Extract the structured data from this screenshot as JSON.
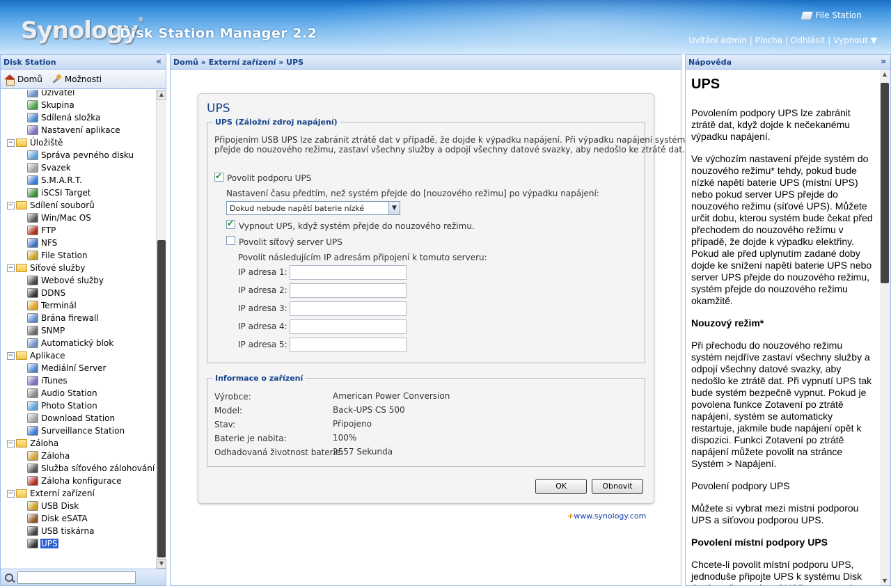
{
  "header": {
    "logo": "Synology",
    "logo_mark": "®",
    "product": "Disk Station Manager 2.2",
    "file_station_link": "File Station",
    "links": [
      "Uvítání admin",
      "Plocha",
      "Odhlásit",
      "Vypnout ▼"
    ]
  },
  "left_panel": {
    "title": "Disk Station",
    "toolbar": {
      "home": "Domů",
      "options": "Možnosti"
    },
    "tree": [
      {
        "label": "Uživatel",
        "indent": 2,
        "icon": "user-icon"
      },
      {
        "label": "Skupina",
        "indent": 2,
        "icon": "group-icon"
      },
      {
        "label": "Sdílená složka",
        "indent": 2,
        "icon": "shared-folder-icon"
      },
      {
        "label": "Nastavení aplikace",
        "indent": 2,
        "icon": "app-settings-icon"
      },
      {
        "label": "Úložiště",
        "indent": 1,
        "folder": true
      },
      {
        "label": "Správa pevného disku",
        "indent": 2,
        "icon": "hdd-icon"
      },
      {
        "label": "Svazek",
        "indent": 2,
        "icon": "volume-icon"
      },
      {
        "label": "S.M.A.R.T.",
        "indent": 2,
        "icon": "smart-icon"
      },
      {
        "label": "iSCSI Target",
        "indent": 2,
        "icon": "iscsi-icon"
      },
      {
        "label": "Sdílení souborů",
        "indent": 1,
        "folder": true
      },
      {
        "label": "Win/Mac OS",
        "indent": 2,
        "icon": "winmac-icon"
      },
      {
        "label": "FTP",
        "indent": 2,
        "icon": "ftp-icon"
      },
      {
        "label": "NFS",
        "indent": 2,
        "icon": "nfs-icon"
      },
      {
        "label": "File Station",
        "indent": 2,
        "icon": "file-station-icon"
      },
      {
        "label": "Síťové služby",
        "indent": 1,
        "folder": true
      },
      {
        "label": "Webové služby",
        "indent": 2,
        "icon": "web-icon"
      },
      {
        "label": "DDNS",
        "indent": 2,
        "icon": "ddns-icon"
      },
      {
        "label": "Terminál",
        "indent": 2,
        "icon": "terminal-icon"
      },
      {
        "label": "Brána firewall",
        "indent": 2,
        "icon": "firewall-icon"
      },
      {
        "label": "SNMP",
        "indent": 2,
        "icon": "snmp-icon"
      },
      {
        "label": "Automatický blok",
        "indent": 2,
        "icon": "lock-icon"
      },
      {
        "label": "Aplikace",
        "indent": 1,
        "folder": true
      },
      {
        "label": "Mediální Server",
        "indent": 2,
        "icon": "media-server-icon"
      },
      {
        "label": "iTunes",
        "indent": 2,
        "icon": "itunes-icon"
      },
      {
        "label": "Audio Station",
        "indent": 2,
        "icon": "audio-icon"
      },
      {
        "label": "Photo Station",
        "indent": 2,
        "icon": "photo-icon"
      },
      {
        "label": "Download Station",
        "indent": 2,
        "icon": "download-icon"
      },
      {
        "label": "Surveillance Station",
        "indent": 2,
        "icon": "camera-icon"
      },
      {
        "label": "Záloha",
        "indent": 1,
        "folder": true
      },
      {
        "label": "Záloha",
        "indent": 2,
        "icon": "backup-icon"
      },
      {
        "label": "Služba síťového zálohování",
        "indent": 2,
        "icon": "network-backup-icon"
      },
      {
        "label": "Záloha konfigurace",
        "indent": 2,
        "icon": "config-backup-icon"
      },
      {
        "label": "Externí zařízení",
        "indent": 1,
        "folder": true
      },
      {
        "label": "USB Disk",
        "indent": 2,
        "icon": "usb-disk-icon"
      },
      {
        "label": "Disk eSATA",
        "indent": 2,
        "icon": "esata-icon"
      },
      {
        "label": "USB tiskárna",
        "indent": 2,
        "icon": "printer-icon"
      },
      {
        "label": "UPS",
        "indent": 2,
        "icon": "ups-icon",
        "selected": true
      }
    ],
    "search_placeholder": ""
  },
  "breadcrumb": "Domů » Externí zařízení » UPS",
  "ups": {
    "title": "UPS",
    "group1_legend": "UPS (Záložní zdroj napájení)",
    "desc_line1": "Připojením USB UPS lze zabránit ztrátě dat v případě, že dojde k výpadku napájení. Při výpadku napájení systém",
    "desc_line2": "přejde do nouzového režimu, zastaví všechny služby a odpojí všechny datové svazky, aby nedošlo ke ztrátě dat.",
    "enable_ups": "Povolit podporu UPS",
    "enable_ups_checked": true,
    "time_label": "Nastavení času předtím, než systém přejde do [nouzového režimu] po výpadku napájení:",
    "time_value": "Dokud nebude napětí baterie nízké",
    "shutdown_ups": "Vypnout UPS, když systém přejde do nouzového režimu.",
    "shutdown_checked": true,
    "net_server": "Povolit síťový server UPS",
    "net_server_checked": false,
    "allow_ips": "Povolit následujícím IP adresám připojení k tomuto serveru:",
    "ip_labels": [
      "IP adresa 1:",
      "IP adresa 2:",
      "IP adresa 3:",
      "IP adresa 4:",
      "IP adresa 5:"
    ],
    "ip_values": [
      "",
      "",
      "",
      "",
      ""
    ],
    "group2_legend": "Informace o zařízení",
    "info": [
      {
        "label": "Výrobce:",
        "value": "American Power Conversion"
      },
      {
        "label": "Model:",
        "value": "Back-UPS CS 500"
      },
      {
        "label": "Stav:",
        "value": "Připojeno"
      },
      {
        "label": "Baterie je nabita:",
        "value": "100%"
      },
      {
        "label": "Odhadovaná životnost baterie:",
        "value": "2557 Sekunda"
      }
    ],
    "ok": "OK",
    "reset": "Obnovit"
  },
  "footer_link": "www.synology.com",
  "help": {
    "title_bar": "Nápověda",
    "h1": "UPS",
    "p1": "Povolením podpory UPS lze zabránit ztrátě dat, když dojde k nečekanému výpadku napájení.",
    "p2": "Ve výchozím nastavení přejde systém do nouzového režimu* tehdy, pokud bude nízké napětí baterie UPS (místní UPS) nebo pokud server UPS přejde do nouzového režimu (síťové UPS). Můžete určit dobu, kterou systém bude čekat před přechodem do nouzového režimu v případě, že dojde k výpadku elektřiny. Pokud ale před uplynutím zadané doby dojde ke snížení napětí baterie UPS nebo server UPS přejde do nouzového režimu, systém přejde do nouzového režimu okamžitě.",
    "h2a": "Nouzový režim*",
    "p3": "Při přechodu do nouzového režimu systém nejdříve zastaví všechny služby a odpojí všechny datové svazky, aby nedošlo ke ztrátě dat. Při vypnutí UPS tak bude systém bezpečně vypnut. Pokud je povolena funkce Zotavení po ztrátě napájení, systém se automaticky restartuje, jakmile bude napájení opět k dispozici. Funkci Zotavení po ztrátě napájení můžete povolit na stránce Systém > Napájení.",
    "p4": "Povolení podpory UPS",
    "p5": "Můžete si vybrat mezi místní podporou UPS a síťovou podporou UPS.",
    "h2b": "Povolení místní podpory UPS",
    "p6": "Chcete-li povolit místní podporu UPS, jednoduše připojte UPS k systému Disk Station přes rozhraní USB a postupujte"
  },
  "colors": {
    "accent": "#15428b",
    "selected": "#2a5fd4",
    "link": "#1a3fa8"
  }
}
